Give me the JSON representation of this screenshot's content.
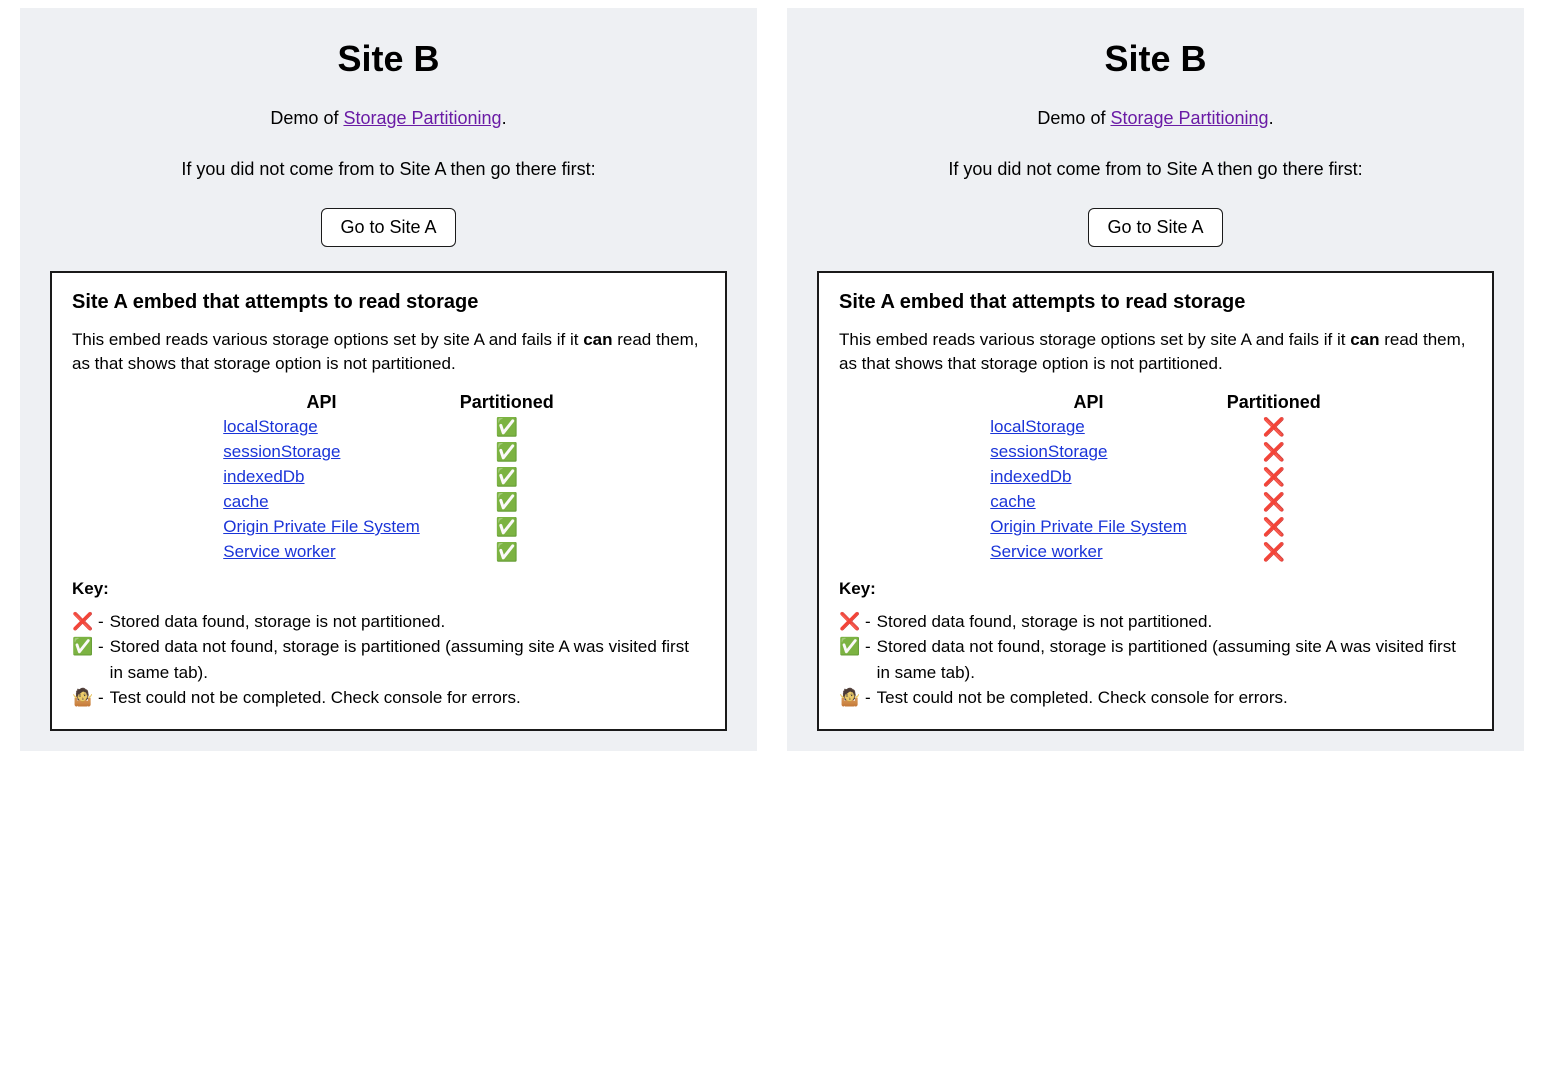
{
  "panels": [
    {
      "title": "Site B",
      "demoPrefix": "Demo of ",
      "demoLinkText": "Storage Partitioning",
      "demoSuffix": ".",
      "instruction": "If you did not come from to Site A then go there first:",
      "buttonLabel": "Go to Site A",
      "embedTitle": "Site A embed that attempts to read storage",
      "embedDescPrefix": "This embed reads various storage options set by site A and fails if it ",
      "embedDescBold": "can",
      "embedDescSuffix": " read them, as that shows that storage option is not partitioned.",
      "tableHeaders": {
        "api": "API",
        "partitioned": "Partitioned"
      },
      "rows": [
        {
          "api": "localStorage",
          "status": "check"
        },
        {
          "api": "sessionStorage",
          "status": "check"
        },
        {
          "api": "indexedDb",
          "status": "check"
        },
        {
          "api": "cache",
          "status": "check"
        },
        {
          "api": "Origin Private File System",
          "status": "check"
        },
        {
          "api": "Service worker",
          "status": "check"
        }
      ],
      "keyTitle": "Key:",
      "keyItems": [
        {
          "icon": "cross",
          "text": "Stored data found, storage is not partitioned."
        },
        {
          "icon": "check",
          "text": "Stored data not found, storage is partitioned (assuming site A was visited first in same tab)."
        },
        {
          "icon": "ambig",
          "text": "Test could not be completed. Check console for errors."
        }
      ]
    },
    {
      "title": "Site B",
      "demoPrefix": "Demo of ",
      "demoLinkText": "Storage Partitioning",
      "demoSuffix": ".",
      "instruction": "If you did not come from to Site A then go there first:",
      "buttonLabel": "Go to Site A",
      "embedTitle": "Site A embed that attempts to read storage",
      "embedDescPrefix": "This embed reads various storage options set by site A and fails if it ",
      "embedDescBold": "can",
      "embedDescSuffix": " read them, as that shows that storage option is not partitioned.",
      "tableHeaders": {
        "api": "API",
        "partitioned": "Partitioned"
      },
      "rows": [
        {
          "api": "localStorage",
          "status": "cross"
        },
        {
          "api": "sessionStorage",
          "status": "cross"
        },
        {
          "api": "indexedDb",
          "status": "cross"
        },
        {
          "api": "cache",
          "status": "cross"
        },
        {
          "api": "Origin Private File System",
          "status": "cross"
        },
        {
          "api": "Service worker",
          "status": "cross"
        }
      ],
      "keyTitle": "Key:",
      "keyItems": [
        {
          "icon": "cross",
          "text": "Stored data found, storage is not partitioned."
        },
        {
          "icon": "check",
          "text": "Stored data not found, storage is partitioned (assuming site A was visited first in same tab)."
        },
        {
          "icon": "ambig",
          "text": "Test could not be completed. Check console for errors."
        }
      ]
    }
  ],
  "icons": {
    "check": "✅",
    "cross": "❌",
    "ambig": "🤷"
  }
}
